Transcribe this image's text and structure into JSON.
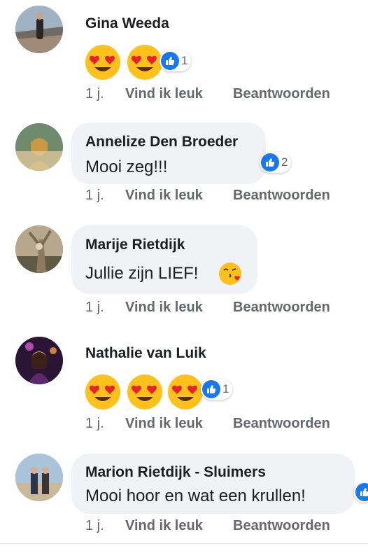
{
  "comments": [
    {
      "name": "Gina Weeda",
      "text": "",
      "emoji": [
        "heart-eyes",
        "heart-eyes"
      ],
      "reactions": "1",
      "time": "1 j.",
      "like": "Vind ik leuk",
      "reply": "Beantwoorden"
    },
    {
      "name": "Annelize Den Broeder",
      "text": "Mooi zeg!!!",
      "reactions": "2",
      "time": "1 j.",
      "like": "Vind ik leuk",
      "reply": "Beantwoorden"
    },
    {
      "name": "Marije Rietdijk",
      "text": "Jullie zijn LIEF! ",
      "emoji": [
        "kissing-heart"
      ],
      "time": "1 j.",
      "like": "Vind ik leuk",
      "reply": "Beantwoorden"
    },
    {
      "name": "Nathalie van Luik",
      "text": "",
      "emoji": [
        "heart-eyes",
        "heart-eyes",
        "heart-eyes"
      ],
      "reactions": "1",
      "time": "1 j.",
      "like": "Vind ik leuk",
      "reply": "Beantwoorden"
    },
    {
      "name": "Marion Rietdijk - Sluimers",
      "text": "Mooi hoor en wat een krullen!",
      "time": "1 j.",
      "like": "Vind ik leuk",
      "reply": "Beantwoorden"
    }
  ],
  "colors": {
    "like_blue": "#1877f2",
    "bubble": "#f0f2f5",
    "meta": "#65676b"
  }
}
